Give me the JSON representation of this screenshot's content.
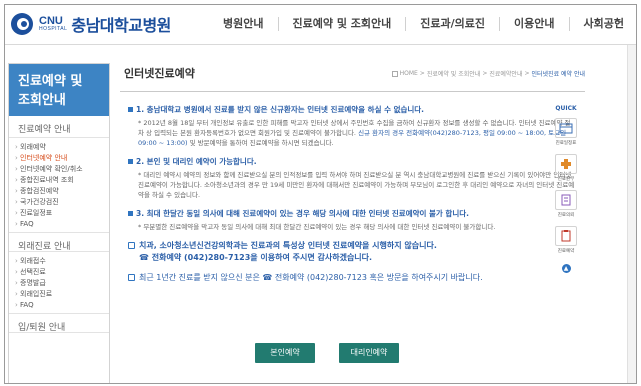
{
  "header": {
    "logo_en_1": "CNU",
    "logo_en_2": "HOSPITAL",
    "logo_ko": "충남대학교병원",
    "nav": [
      "병원안내",
      "진료예약 및 조회안내",
      "진료과/의료진",
      "이용안내",
      "사회공헌"
    ]
  },
  "sidebar": {
    "title_1": "진료예약 및",
    "title_2": "조회안내",
    "section1": "진료예약 안내",
    "items1": [
      "외래예약",
      "인터넷예약 안내",
      "인터넷예약 확인/취소",
      "종합진료내역 조회",
      "종합검진예약",
      "국가건강검진",
      "진료일정표",
      "FAQ"
    ],
    "section2": "외래진료 안내",
    "items2": [
      "외래접수",
      "선택진료",
      "증명발급",
      "외래입진료",
      "FAQ"
    ],
    "section3": "입/퇴원 안내"
  },
  "content": {
    "title": "인터넷진료예약",
    "breadcrumb": [
      "HOME",
      "진료예약 및 조회안내",
      "진료예약안내",
      "인터넷진료 예약 안내"
    ],
    "s1_head": "1. 충남대학교 병원에서 진료를 받지 않은 신규환자는 인터넷 진료예약을 하실 수 없습니다.",
    "s1_body1": "* 2012년 8월 18일 부터 개인정보 유출로 인한 피해를 막고자 인터넷 상에서 주민번호 수집을 금하여 신규환자 정보를 생성할 수 없습니다. 인터넷 진료예약 절차 상 입력되는 본원 환자등록번호가 없으면 회원가입 및 진료예약이 불가합니다. 신규 환자의 경우 전화예약(042)280-7123, 평일 09:00 ~ 18:00, 토요일 09:00 ~ 13:00) 및 방문예약을 통하여 진료예약을 하시면 되겠습니다.",
    "s1_body_pre": "* 2012년 8월 18일 부터 개인정보 유출로 인한 피해를 막고자 인터넷 상에서 주민번호 수집을 금하여 신규환자 정보를 생성할 수 없습니다. 인터넷 진료예약 절차 상 입력되는 본원 환자등록번호가 없으면 회원가입 및 진료예약이 불가합니다. ",
    "s1_body_hl": "신규 환자의 경우 전화예약(042)280-7123, 평일 09:00 ~ 18:00, 토요일 09:00 ~ 13:00)",
    "s1_body_post": " 및 방문예약을 통하여 진료예약을 하시면 되겠습니다.",
    "s2_head": "2. 본인 및 대리인 예약이 가능합니다.",
    "s2_body": "* 대리인 예약시 예약의 정보와 함께 진료받으실 분의 인적정보를 입력 하셔야 하며 진료받으실 분 역시 충남대학교병원에 진료를 받으신 기록이 있어야만 인터넷 진료예약이 가능합니다. 소아청소년과의 경우 만 19세 미만인 환자에 대해서만 진료예약이 가능하며 부모님이 로그인한 후 대리인 예약으로 자녀의 인터넷 진료예약을 하실 수 있습니다.",
    "s3_head": "3. 최대 한달간 동일 의사에 대해 진료예약이 있는 경우 해당 의사에 대한 인터넷 진료예약이 불가 합니다.",
    "s3_body": "* 무분별한 진료예약을 막고자 동일 의사에 대해 최대 한달간 진료예약이 있는 경우 해당 의사에 대한 인터넷 진료예약이 불가합니다.",
    "notice1_a": "치과, 소아청소년신건강의학과는 진료과의 특성상 인터넷 진료예약을 시행하지 않습니다.",
    "notice1_b": "☎ 전화예약 (042)280-7123을 이용하여 주시면 감사하겠습니다.",
    "notice2": "최근 1년간 진료를 받지 않으신 분은 ☎ 전화예약 (042)280-7123 혹은 방문을 하여주시기 바랍니다.",
    "btn_self": "본인예약",
    "btn_proxy": "대리인예약"
  },
  "quick": {
    "title": "QUICK",
    "items": [
      "진료일정표",
      "진료원무",
      "진료의뢰",
      "진료예약"
    ],
    "top": "▲"
  }
}
